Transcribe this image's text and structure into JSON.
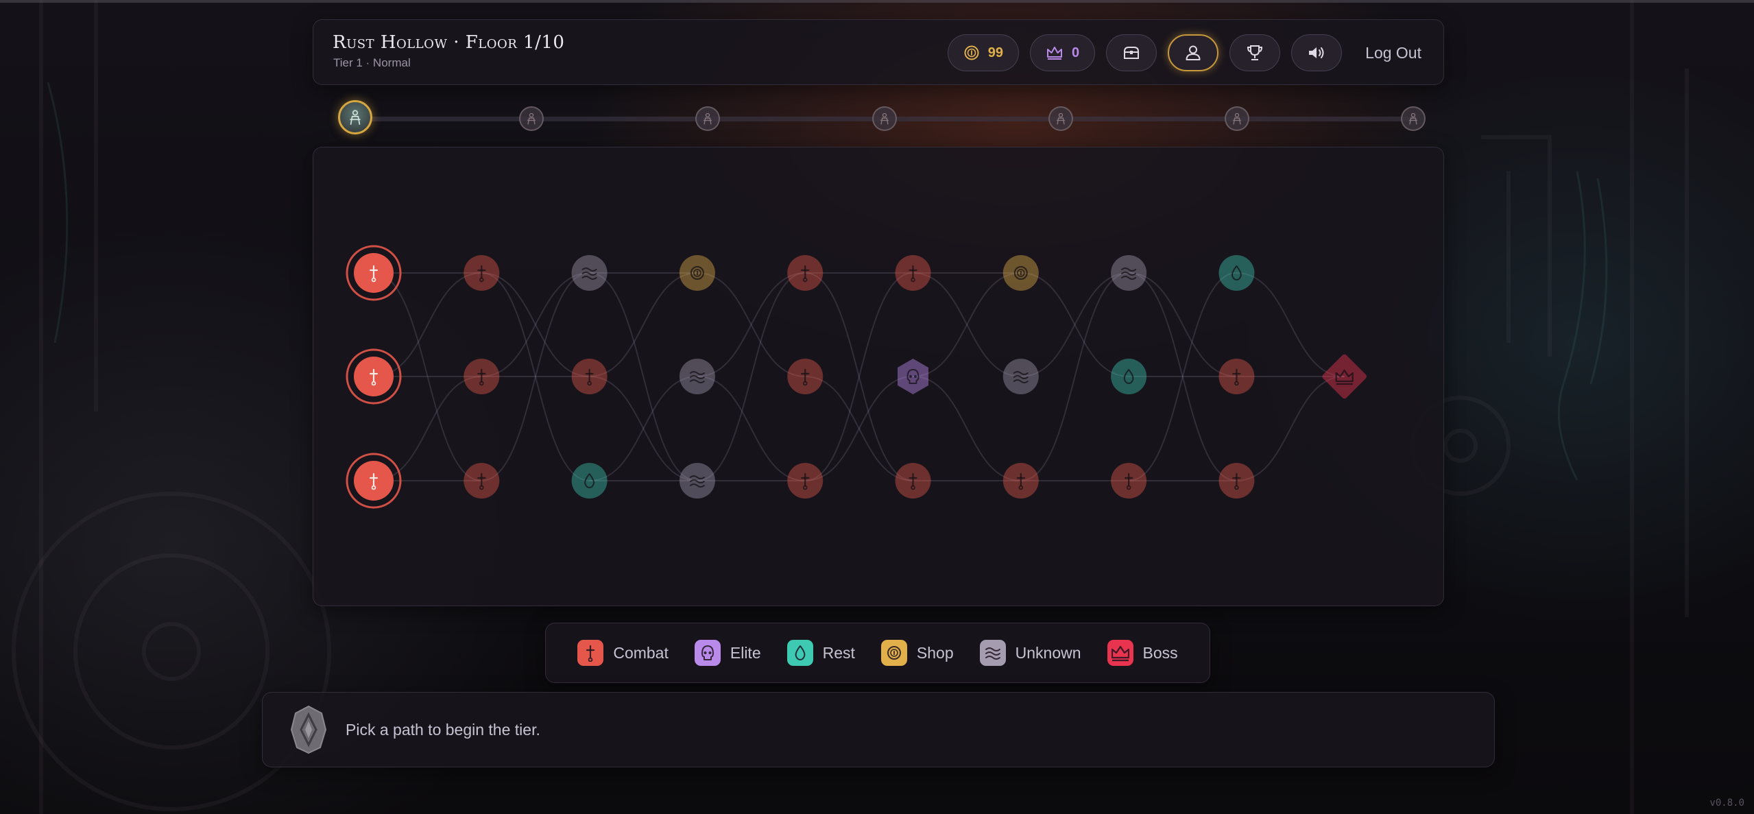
{
  "header": {
    "title": "Rust Hollow · Floor 1/10",
    "subtitle": "Tier 1 · Normal",
    "gold": "99",
    "crowns": "0",
    "logout_label": "Log Out"
  },
  "colors": {
    "combat": "#e5574a",
    "elite": "#b98aea",
    "rest": "#3ec9b2",
    "shop": "#e2b04a",
    "unknown": "#a59cb0",
    "boss": "#e8344f",
    "accent_gold": "#d6a640"
  },
  "icons": {
    "gold": "coin-icon",
    "crowns": "crown-icon",
    "inventory": "chest-icon",
    "profile": "user-icon",
    "achievements": "trophy-icon",
    "sound": "speaker-icon",
    "combat": "dagger-icon",
    "elite": "skull-icon",
    "rest": "drop-icon",
    "shop": "coin-icon",
    "unknown": "waves-icon",
    "boss": "crown-icon",
    "message": "rune-stone-icon"
  },
  "progress": {
    "floors_shown": 7,
    "current": 1
  },
  "map": {
    "columns": [
      [
        "combat",
        "combat",
        "combat"
      ],
      [
        "combat",
        "combat",
        "combat"
      ],
      [
        "unknown",
        "combat",
        "rest"
      ],
      [
        "shop",
        "unknown",
        "unknown"
      ],
      [
        "combat",
        "combat",
        "combat"
      ],
      [
        "combat",
        "elite",
        "combat"
      ],
      [
        "shop",
        "unknown",
        "combat"
      ],
      [
        "unknown",
        "rest",
        "combat"
      ],
      [
        "rest",
        "combat",
        "combat"
      ],
      [
        null,
        "boss",
        null
      ]
    ],
    "available": [
      [
        0,
        0
      ],
      [
        0,
        1
      ],
      [
        0,
        2
      ]
    ],
    "edges": [
      [
        [
          0,
          0
        ],
        [
          1,
          0
        ]
      ],
      [
        [
          0,
          0
        ],
        [
          1,
          2
        ]
      ],
      [
        [
          0,
          1
        ],
        [
          1,
          0
        ]
      ],
      [
        [
          0,
          1
        ],
        [
          1,
          1
        ]
      ],
      [
        [
          0,
          2
        ],
        [
          1,
          1
        ]
      ],
      [
        [
          0,
          2
        ],
        [
          1,
          2
        ]
      ],
      [
        [
          1,
          0
        ],
        [
          2,
          1
        ]
      ],
      [
        [
          1,
          0
        ],
        [
          2,
          2
        ]
      ],
      [
        [
          1,
          1
        ],
        [
          2,
          1
        ]
      ],
      [
        [
          1,
          1
        ],
        [
          2,
          0
        ]
      ],
      [
        [
          1,
          2
        ],
        [
          2,
          0
        ]
      ],
      [
        [
          2,
          0
        ],
        [
          3,
          0
        ]
      ],
      [
        [
          2,
          0
        ],
        [
          3,
          2
        ]
      ],
      [
        [
          2,
          1
        ],
        [
          3,
          0
        ]
      ],
      [
        [
          2,
          1
        ],
        [
          3,
          2
        ]
      ],
      [
        [
          2,
          2
        ],
        [
          3,
          1
        ]
      ],
      [
        [
          2,
          2
        ],
        [
          3,
          2
        ]
      ],
      [
        [
          3,
          0
        ],
        [
          4,
          1
        ]
      ],
      [
        [
          3,
          1
        ],
        [
          4,
          0
        ]
      ],
      [
        [
          3,
          1
        ],
        [
          4,
          2
        ]
      ],
      [
        [
          3,
          2
        ],
        [
          4,
          0
        ]
      ],
      [
        [
          3,
          2
        ],
        [
          4,
          2
        ]
      ],
      [
        [
          4,
          0
        ],
        [
          5,
          0
        ]
      ],
      [
        [
          4,
          0
        ],
        [
          5,
          2
        ]
      ],
      [
        [
          4,
          1
        ],
        [
          5,
          2
        ]
      ],
      [
        [
          4,
          2
        ],
        [
          5,
          1
        ]
      ],
      [
        [
          4,
          2
        ],
        [
          5,
          0
        ]
      ],
      [
        [
          5,
          0
        ],
        [
          6,
          1
        ]
      ],
      [
        [
          5,
          0
        ],
        [
          6,
          0
        ]
      ],
      [
        [
          5,
          1
        ],
        [
          6,
          2
        ]
      ],
      [
        [
          5,
          1
        ],
        [
          6,
          0
        ]
      ],
      [
        [
          5,
          2
        ],
        [
          6,
          2
        ]
      ],
      [
        [
          6,
          0
        ],
        [
          7,
          1
        ]
      ],
      [
        [
          6,
          1
        ],
        [
          7,
          0
        ]
      ],
      [
        [
          6,
          2
        ],
        [
          7,
          2
        ]
      ],
      [
        [
          6,
          2
        ],
        [
          7,
          0
        ]
      ],
      [
        [
          7,
          0
        ],
        [
          8,
          1
        ]
      ],
      [
        [
          7,
          0
        ],
        [
          8,
          2
        ]
      ],
      [
        [
          7,
          1
        ],
        [
          8,
          1
        ]
      ],
      [
        [
          7,
          2
        ],
        [
          8,
          0
        ]
      ],
      [
        [
          7,
          2
        ],
        [
          8,
          2
        ]
      ],
      [
        [
          8,
          0
        ],
        [
          9,
          1
        ]
      ],
      [
        [
          8,
          1
        ],
        [
          9,
          1
        ]
      ],
      [
        [
          8,
          2
        ],
        [
          9,
          1
        ]
      ]
    ]
  },
  "legend": [
    {
      "type": "combat",
      "label": "Combat"
    },
    {
      "type": "elite",
      "label": "Elite"
    },
    {
      "type": "rest",
      "label": "Rest"
    },
    {
      "type": "shop",
      "label": "Shop"
    },
    {
      "type": "unknown",
      "label": "Unknown"
    },
    {
      "type": "boss",
      "label": "Boss"
    }
  ],
  "message": {
    "text": "Pick a path to begin the tier."
  },
  "version": "v0.8.0"
}
